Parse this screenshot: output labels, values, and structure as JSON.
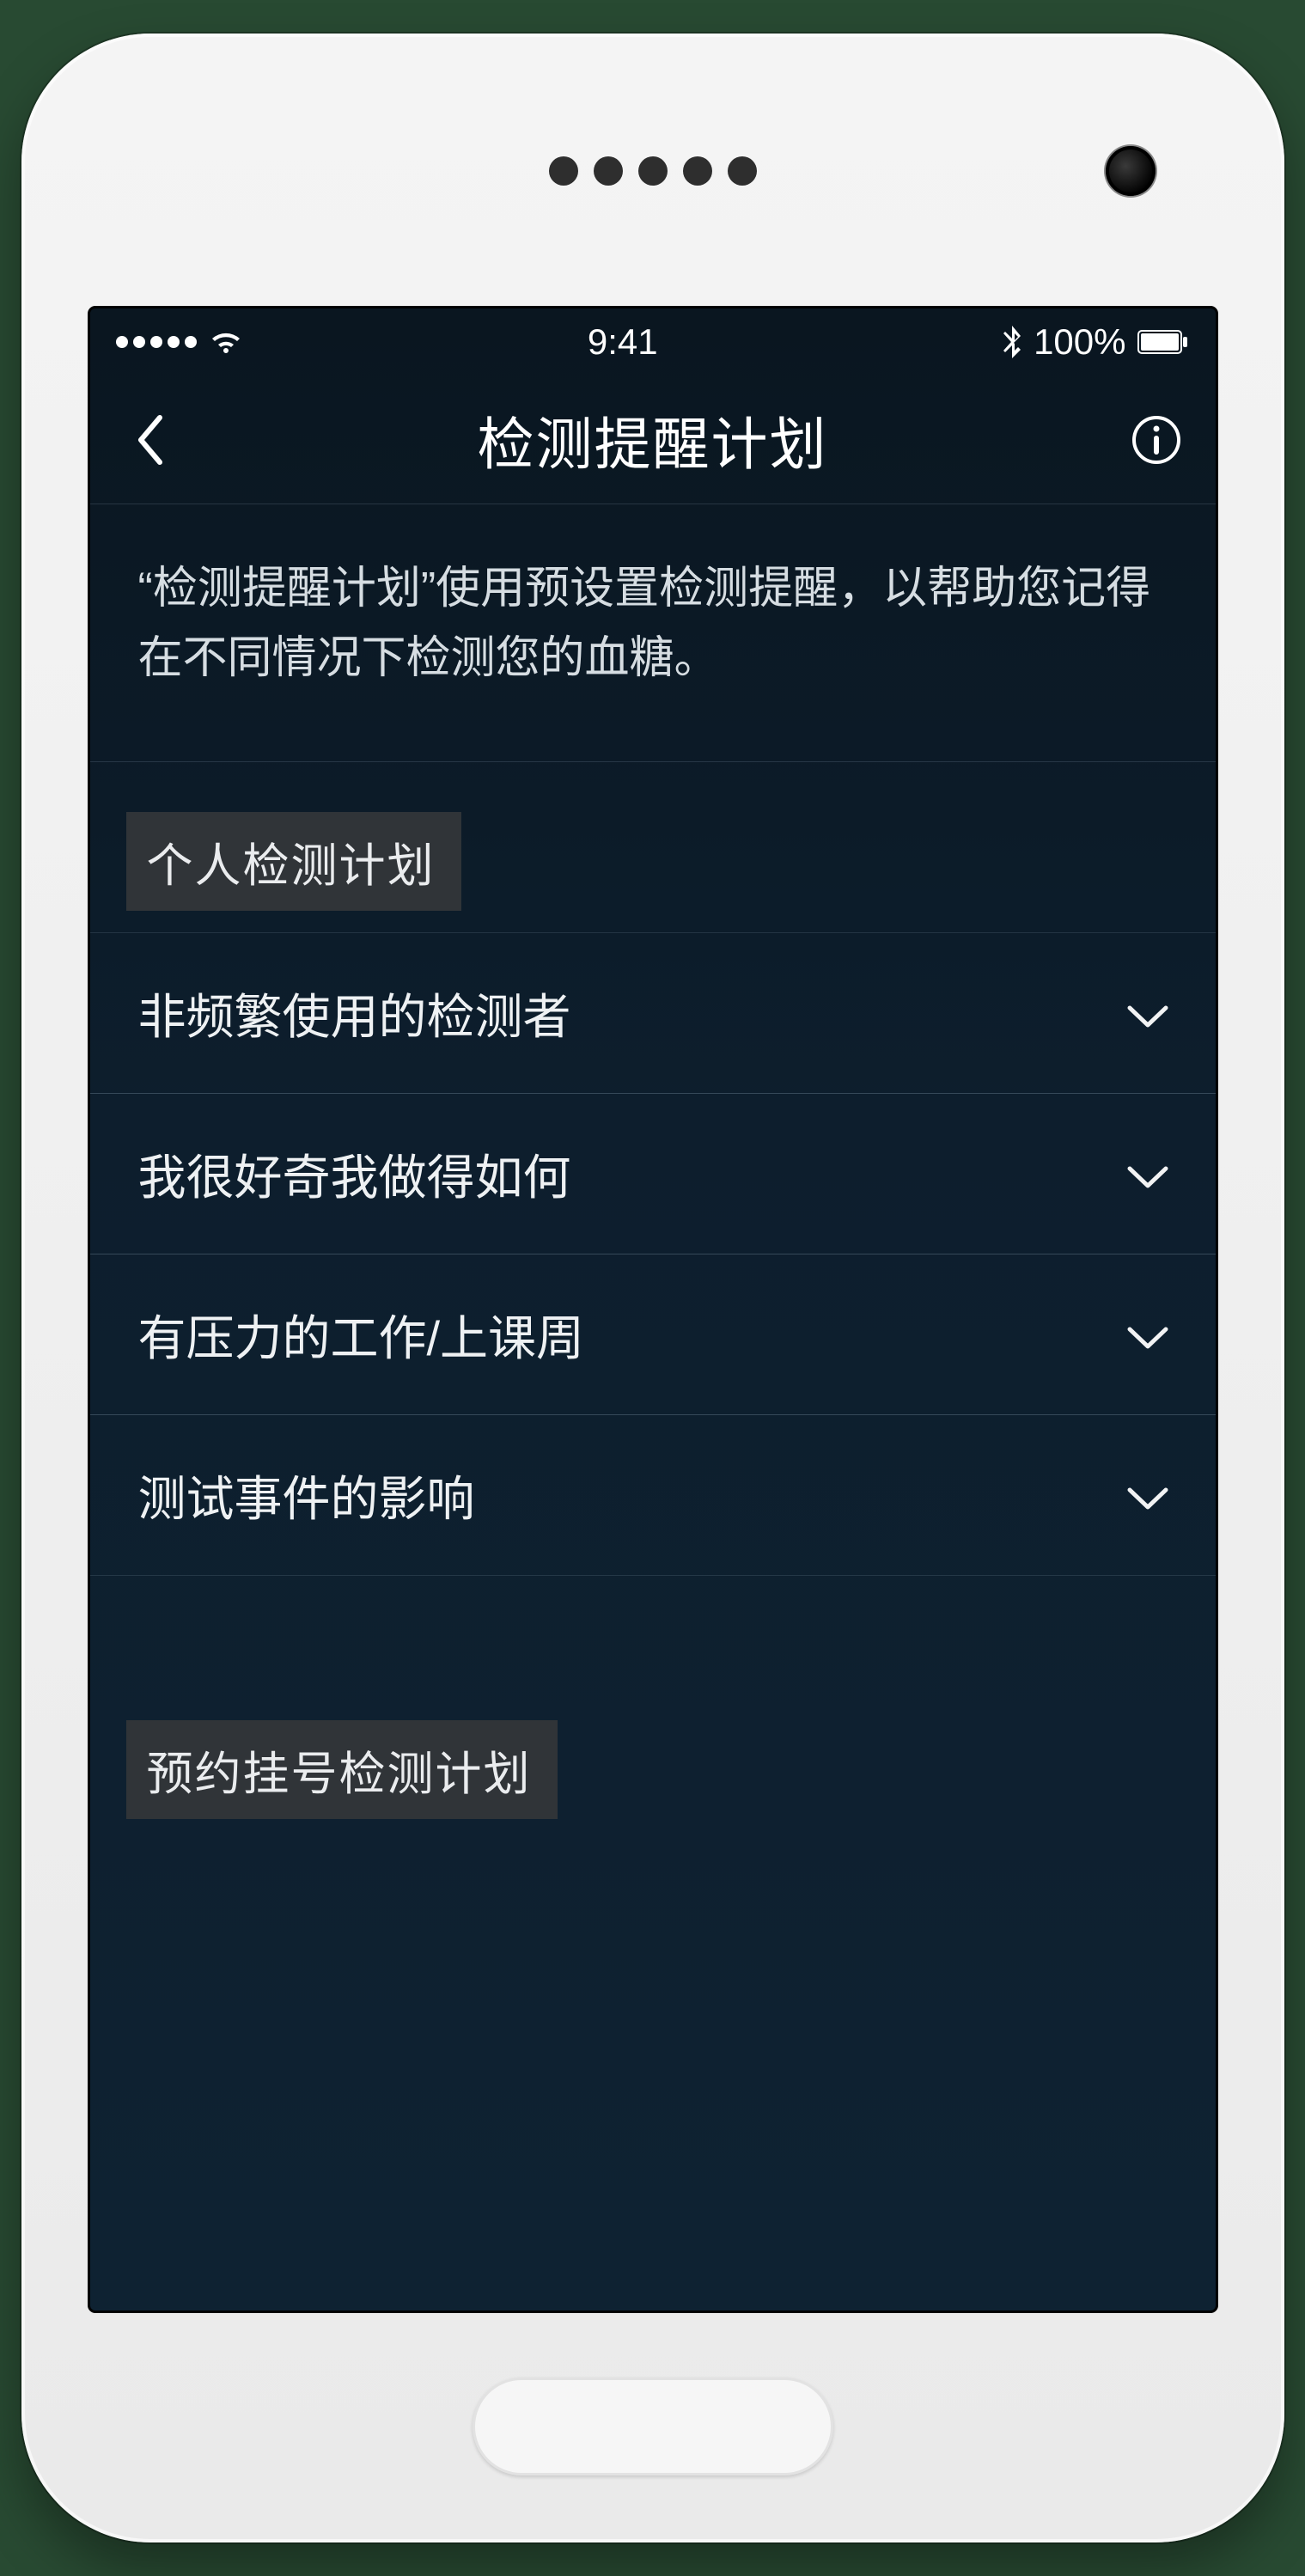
{
  "status": {
    "time": "9:41",
    "battery_text": "100%"
  },
  "nav": {
    "title": "检测提醒计划"
  },
  "description": "“检测提醒计划”使用预设置检测提醒，以帮助您记得在不同情况下检测您的血糖。",
  "section1": {
    "header": "个人检测计划",
    "rows": [
      {
        "label": "非频繁使用的检测者"
      },
      {
        "label": "我很好奇我做得如何"
      },
      {
        "label": "有压力的工作/上课周"
      },
      {
        "label": "测试事件的影响"
      }
    ]
  },
  "section2": {
    "header": "预约挂号检测计划"
  }
}
